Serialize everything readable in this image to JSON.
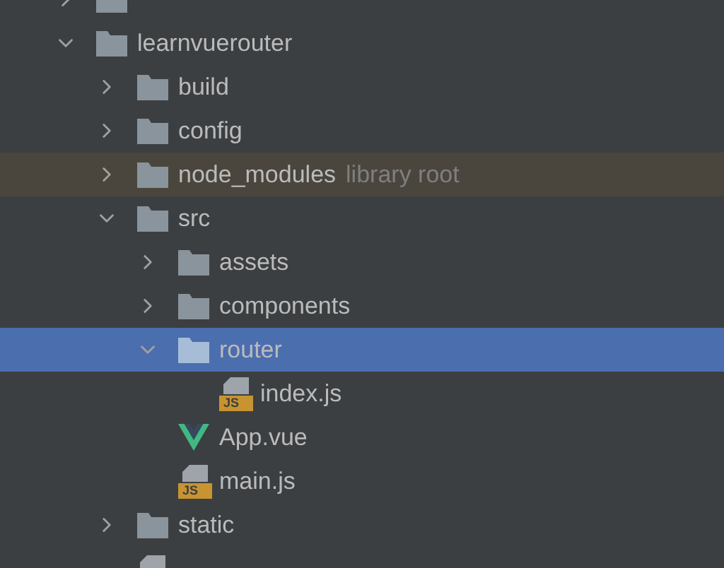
{
  "tree": [
    {
      "kind": "folder",
      "expanded": false,
      "selected": false,
      "highlighted": false
    },
    {
      "name": "learnvuerouter",
      "kind": "folder",
      "expanded": true,
      "selected": false,
      "highlighted": false,
      "children": [
        {
          "name": "build",
          "kind": "folder",
          "expanded": false,
          "selected": false,
          "highlighted": false
        },
        {
          "name": "config",
          "kind": "folder",
          "expanded": false,
          "selected": false,
          "highlighted": false
        },
        {
          "name": "node_modules",
          "note": "library root",
          "kind": "folder",
          "expanded": false,
          "selected": false,
          "highlighted": true
        },
        {
          "name": "src",
          "kind": "folder",
          "expanded": true,
          "selected": false,
          "highlighted": false,
          "children": [
            {
              "name": "assets",
              "kind": "folder",
              "expanded": false,
              "selected": false,
              "highlighted": false
            },
            {
              "name": "components",
              "kind": "folder",
              "expanded": false,
              "selected": false,
              "highlighted": false
            },
            {
              "name": "router",
              "kind": "folder",
              "expanded": true,
              "selected": true,
              "highlighted": false,
              "children": [
                {
                  "name": "index.js",
                  "kind": "js",
                  "badge": "JS",
                  "selected": false,
                  "highlighted": false
                }
              ]
            },
            {
              "name": "App.vue",
              "kind": "vue",
              "selected": false,
              "highlighted": false
            },
            {
              "name": "main.js",
              "kind": "js",
              "badge": "JS",
              "selected": false,
              "highlighted": false
            }
          ]
        },
        {
          "name": "static",
          "kind": "folder",
          "expanded": false,
          "selected": false,
          "highlighted": false
        },
        {
          "kind": "file",
          "selected": false,
          "highlighted": false
        }
      ]
    }
  ]
}
